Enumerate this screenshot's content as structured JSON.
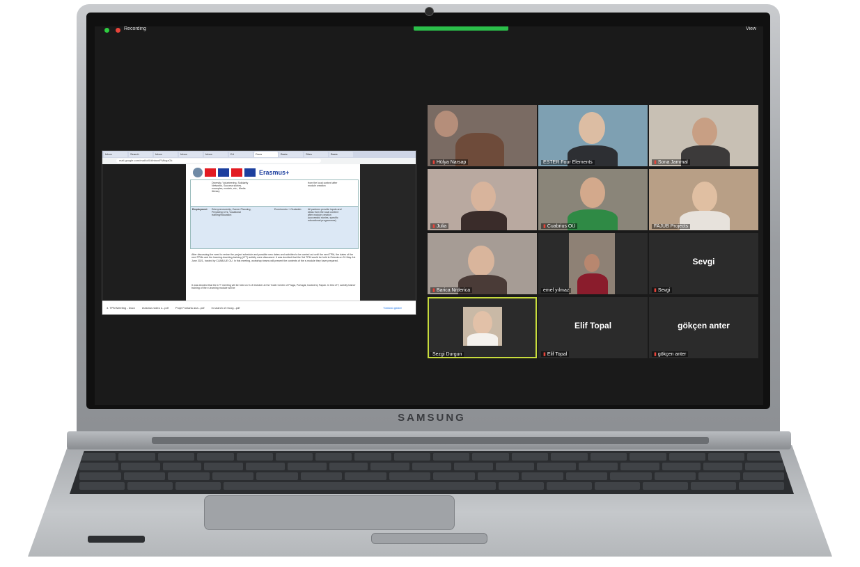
{
  "device": {
    "brand": "SAMSUNG"
  },
  "zoom": {
    "recording_label": "Recording",
    "view_label": "View"
  },
  "browser": {
    "tabs": [
      "Inbox",
      "Search",
      "Inbox",
      "Inbox",
      "Inbox",
      "Ed",
      "Docs",
      "Basic",
      "Sites",
      "Basic"
    ],
    "url": "mail.google.com/mail/u/0/#inbox/FMfcgzGk"
  },
  "document": {
    "logo_text": "Erasmus+",
    "row1_col1": "",
    "row1_col2": "Diversity, Volunteering, Solidarity Networks, Success stories, examples, models, etc., Media literacy",
    "row1_col4": "from the local context after module creation",
    "row2_col1": "Employment",
    "row2_col2": "Entrepreneurship, Career Planning, Preparing CVs, Vocational training/education",
    "row2_col3": "Evenimento + Ciudadub",
    "row2_col4": "All partners provide inputs and ideas from the local context after module creation (successful stories, specific educational programmes)",
    "para1": "After discussing the need to revise the project schedule and possible new dates and activities to be carried out until the next TPM, the dates of the next TPMs and the learning-teaching-training (LTT) activity were discussed. It was decided that the 3rd TPM would be held in Estonia on 31 May-1st June 2021, hosted by CUABLUE OU. In this meeting, workshop teams will present the contents of the e-module they have prepared.",
    "para2": "It was decided that the LTT meeting will be held on 9-15 October at the Youth Center of Praga, Portugal, hosted by Fapub. In this LTT, activity trainer training of the e-learning module will be"
  },
  "downloads": {
    "items": [
      "3. TPM Meeting - Docx",
      "erasmus video s...pdf",
      "Proje Fonlarla ana...pdf",
      "In search of recog...pdf"
    ],
    "show_all": "Tümünü göster"
  },
  "participants": [
    {
      "name": "Hülya Narsap",
      "muted": true,
      "video": true
    },
    {
      "name": "ESTER Four Elements",
      "muted": false,
      "video": true
    },
    {
      "name": "Sona Jammal",
      "muted": true,
      "video": true
    },
    {
      "name": "Julia",
      "muted": true,
      "video": true
    },
    {
      "name": "Cuabrius OÜ",
      "muted": true,
      "video": true
    },
    {
      "name": "FAJUB Projects",
      "muted": false,
      "video": true
    },
    {
      "name": "Barica Nrderica",
      "muted": true,
      "video": true
    },
    {
      "name": "emel yılmaz",
      "muted": false,
      "video": true
    },
    {
      "name": "Sevgi",
      "muted": true,
      "video": false
    },
    {
      "name": "Sezgi Durgun",
      "muted": false,
      "video": false,
      "has_avatar": true,
      "active": true
    },
    {
      "name": "Elif Topal",
      "muted": true,
      "video": false
    },
    {
      "name": "gökçen anter",
      "muted": true,
      "video": false
    }
  ]
}
